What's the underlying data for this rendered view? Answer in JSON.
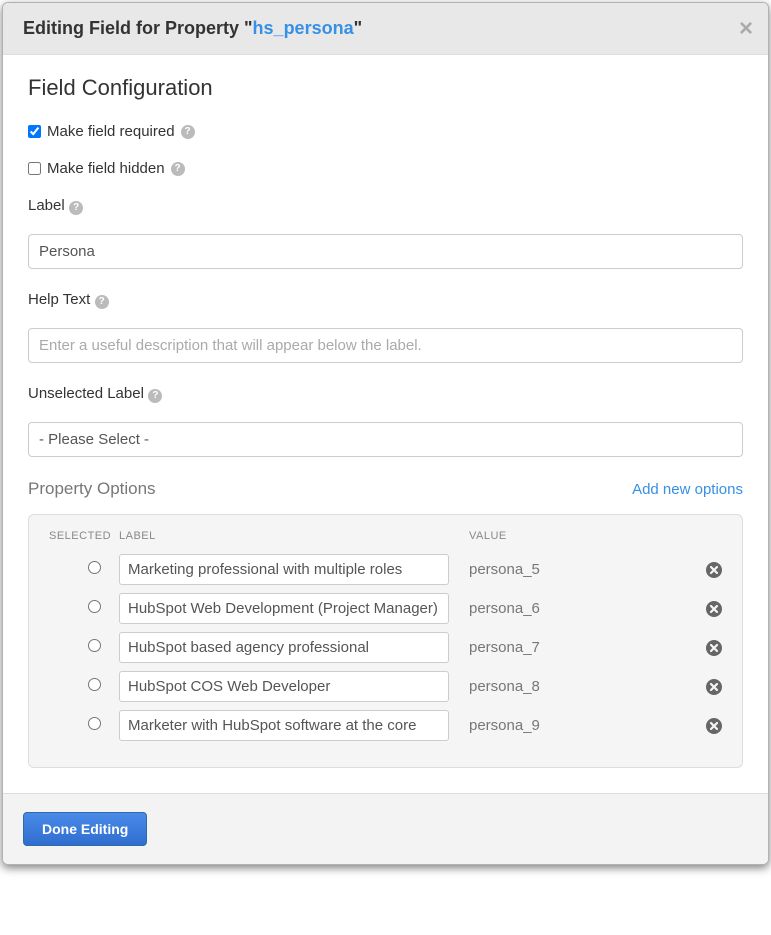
{
  "header": {
    "title_prefix": "Editing Field for Property \"",
    "property_name": "hs_persona",
    "title_suffix": "\""
  },
  "section_title": "Field Configuration",
  "checkboxes": {
    "required_label": "Make field required",
    "hidden_label": "Make field hidden"
  },
  "label_field": {
    "label": "Label",
    "value": "Persona"
  },
  "help_text_field": {
    "label": "Help Text",
    "placeholder": "Enter a useful description that will appear below the label."
  },
  "unselected_label_field": {
    "label": "Unselected Label",
    "value": "- Please Select -"
  },
  "options": {
    "title": "Property Options",
    "add_link": "Add new options",
    "col_selected": "SELECTED",
    "col_label": "LABEL",
    "col_value": "VALUE",
    "rows": [
      {
        "label": "Marketing professional with multiple roles",
        "value": "persona_5"
      },
      {
        "label": "HubSpot Web Development (Project Manager)",
        "value": "persona_6"
      },
      {
        "label": "HubSpot based agency professional",
        "value": "persona_7"
      },
      {
        "label": "HubSpot COS Web Developer",
        "value": "persona_8"
      },
      {
        "label": "Marketer with HubSpot software at the core",
        "value": "persona_9"
      }
    ]
  },
  "footer": {
    "done_label": "Done Editing"
  }
}
